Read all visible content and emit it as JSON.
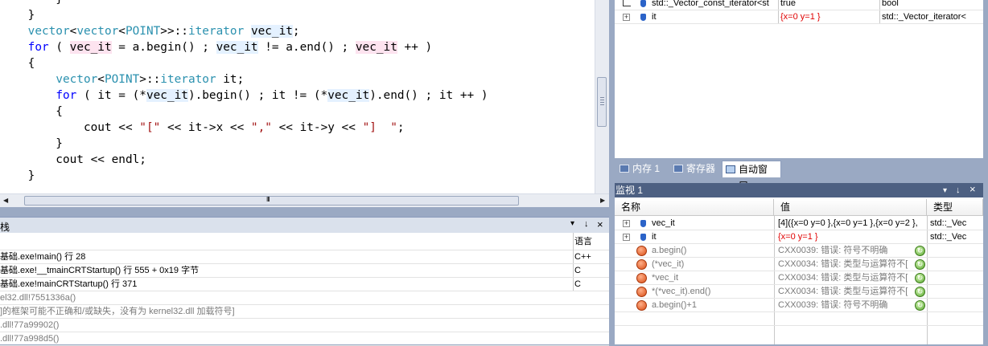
{
  "editor": {
    "lines": [
      {
        "segments": [
          {
            "t": "        }",
            "c": ""
          }
        ]
      },
      {
        "segments": [
          {
            "t": "    }",
            "c": ""
          }
        ]
      },
      {
        "segments": [
          {
            "t": "    ",
            "c": ""
          },
          {
            "t": "vector",
            "c": "ty"
          },
          {
            "t": "<",
            "c": ""
          },
          {
            "t": "vector",
            "c": "ty"
          },
          {
            "t": "<",
            "c": ""
          },
          {
            "t": "POINT",
            "c": "ty"
          },
          {
            "t": ">>::",
            "c": ""
          },
          {
            "t": "iterator",
            "c": "ty"
          },
          {
            "t": " ",
            "c": ""
          },
          {
            "t": "vec_it",
            "c": "hl"
          },
          {
            "t": ";",
            "c": ""
          }
        ]
      },
      {
        "segments": [
          {
            "t": "    ",
            "c": ""
          },
          {
            "t": "for",
            "c": "kw"
          },
          {
            "t": " ( ",
            "c": ""
          },
          {
            "t": "vec_it",
            "c": "hl2"
          },
          {
            "t": " = a.begin() ; ",
            "c": ""
          },
          {
            "t": "vec_it",
            "c": "hl"
          },
          {
            "t": " != a.end() ; ",
            "c": ""
          },
          {
            "t": "vec_it",
            "c": "hl2"
          },
          {
            "t": " ++ )",
            "c": ""
          }
        ]
      },
      {
        "segments": [
          {
            "t": "    {",
            "c": ""
          }
        ]
      },
      {
        "segments": [
          {
            "t": "        ",
            "c": ""
          },
          {
            "t": "vector",
            "c": "ty"
          },
          {
            "t": "<",
            "c": ""
          },
          {
            "t": "POINT",
            "c": "ty"
          },
          {
            "t": ">::",
            "c": ""
          },
          {
            "t": "iterator",
            "c": "ty"
          },
          {
            "t": " it;",
            "c": ""
          }
        ]
      },
      {
        "segments": [
          {
            "t": "        ",
            "c": ""
          },
          {
            "t": "for",
            "c": "kw"
          },
          {
            "t": " ( it = (*",
            "c": ""
          },
          {
            "t": "vec_it",
            "c": "hl"
          },
          {
            "t": ").begin() ; it != (*",
            "c": ""
          },
          {
            "t": "vec_it",
            "c": "hl"
          },
          {
            "t": ").end() ; it ++ )",
            "c": ""
          }
        ]
      },
      {
        "segments": [
          {
            "t": "        {",
            "c": ""
          }
        ]
      },
      {
        "segments": [
          {
            "t": "            cout << ",
            "c": ""
          },
          {
            "t": "\"[\"",
            "c": "str"
          },
          {
            "t": " << it->x << ",
            "c": ""
          },
          {
            "t": "\",\"",
            "c": "str"
          },
          {
            "t": " << it->y << ",
            "c": ""
          },
          {
            "t": "\"]  \"",
            "c": "str"
          },
          {
            "t": ";",
            "c": ""
          }
        ]
      },
      {
        "segments": [
          {
            "t": "        }",
            "c": ""
          }
        ]
      },
      {
        "segments": [
          {
            "t": "        cout << endl;",
            "c": ""
          }
        ]
      },
      {
        "segments": [
          {
            "t": "    }",
            "c": ""
          }
        ]
      }
    ],
    "scroll_marker": "III"
  },
  "callstack": {
    "title": "栈",
    "column_lang": "语言",
    "rows": [
      {
        "name": "基础.exe!main()  行 28",
        "lang": "C++",
        "grey": false
      },
      {
        "name": "基础.exe!__tmainCRTStartup()  行 555 + 0x19 字节",
        "lang": "C",
        "grey": false
      },
      {
        "name": "基础.exe!mainCRTStartup()  行 371",
        "lang": "C",
        "grey": false
      },
      {
        "name": "el32.dll!7551336a()",
        "lang": "",
        "grey": true
      },
      {
        "name": "]的框架可能不正确和/或缺失，没有为 kernel32.dll 加载符号]",
        "lang": "",
        "grey": true
      },
      {
        "name": ".dll!77a99902()",
        "lang": "",
        "grey": true
      },
      {
        "name": ".dll!77a998d5()",
        "lang": "",
        "grey": true
      }
    ]
  },
  "autos": {
    "rows": [
      {
        "name": "std::_Vector_const_iterator<st",
        "value": "true",
        "type": "bool"
      },
      {
        "name": "it",
        "value": "{x=0 y=1 }",
        "type": "std::_Vector_iterator<"
      }
    ]
  },
  "tabs": [
    {
      "label": "内存 1",
      "active": false
    },
    {
      "label": "寄存器",
      "active": false
    },
    {
      "label": "自动窗口",
      "active": true
    }
  ],
  "watch": {
    "title": "监视 1",
    "col_name": "名称",
    "col_value": "值",
    "col_type": "类型",
    "rows": [
      {
        "name": "vec_it",
        "value": "[4]({x=0 y=0 },{x=0 y=1 },{x=0 y=2 },",
        "type": "std::_Vec",
        "kind": "ok",
        "red": false
      },
      {
        "name": "it",
        "value": "{x=0 y=1 }",
        "type": "std::_Vec",
        "kind": "ok",
        "red": true
      },
      {
        "name": "a.begin()",
        "value": "CXX0039: 错误: 符号不明确",
        "type": "",
        "kind": "err",
        "red": false
      },
      {
        "name": "(*vec_it)",
        "value": "CXX0034: 错误: 类型与运算符不[",
        "type": "",
        "kind": "err",
        "red": false
      },
      {
        "name": "*vec_it",
        "value": "CXX0034: 错误: 类型与运算符不[",
        "type": "",
        "kind": "err",
        "red": false
      },
      {
        "name": "*(*vec_it).end()",
        "value": "CXX0034: 错误: 类型与运算符不[",
        "type": "",
        "kind": "err",
        "red": false
      },
      {
        "name": "a.begin()+1",
        "value": "CXX0039: 错误: 符号不明确",
        "type": "",
        "kind": "err",
        "red": false
      }
    ]
  },
  "glyphs": {
    "plus": "+",
    "pin": "↓",
    "close": "×",
    "dropdown": "▾",
    "refresh": "↻"
  }
}
